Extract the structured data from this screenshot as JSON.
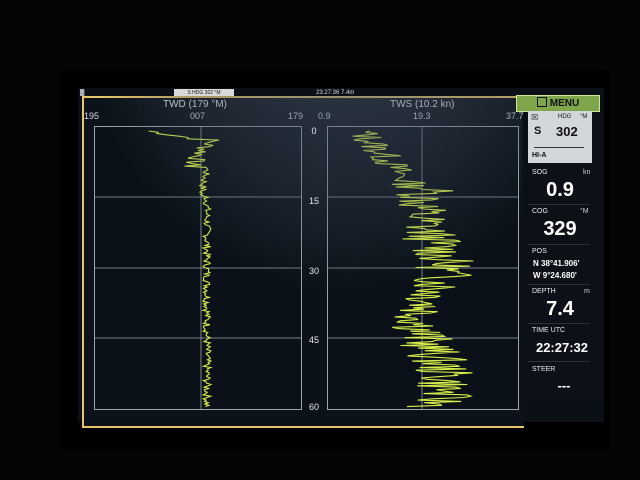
{
  "status_bar": {
    "badge": "S HDG 302 °M",
    "clock": "23:27:36  7.4m"
  },
  "twd_panel": {
    "title": "TWD (179 °M)",
    "tick_left": "195",
    "tick_mid": "007",
    "tick_right": "179"
  },
  "tws_panel": {
    "title": "TWS (10.2 kn)",
    "tick_left": "0.9",
    "tick_mid": "19.3",
    "tick_right": "37.7"
  },
  "depth_axis": {
    "labels": [
      "0",
      "15",
      "30",
      "45",
      "60"
    ]
  },
  "sidebar": {
    "menu_label": "MENU",
    "autopilot": {
      "label": "HDG",
      "unit": "°M",
      "mode_symbol": "S",
      "value": "302",
      "mode": "HI-A"
    },
    "sog": {
      "label": "SOG",
      "unit": "kn",
      "value": "0.9"
    },
    "cog": {
      "label": "COG",
      "unit": "°M",
      "value": "329"
    },
    "pos": {
      "label": "POS",
      "lat": "N  38°41.906'",
      "lon": "W  9°24.680'"
    },
    "depth": {
      "label": "DEPTH",
      "unit": "m",
      "value": "7.4"
    },
    "time": {
      "label": "TIME UTC",
      "value": "22:27:32"
    },
    "steer": {
      "label": "STEER",
      "value": "---"
    }
  },
  "colors": {
    "trace": "#d9ef4a",
    "frame": "#e8c46a",
    "menu": "#7fa64a"
  }
}
